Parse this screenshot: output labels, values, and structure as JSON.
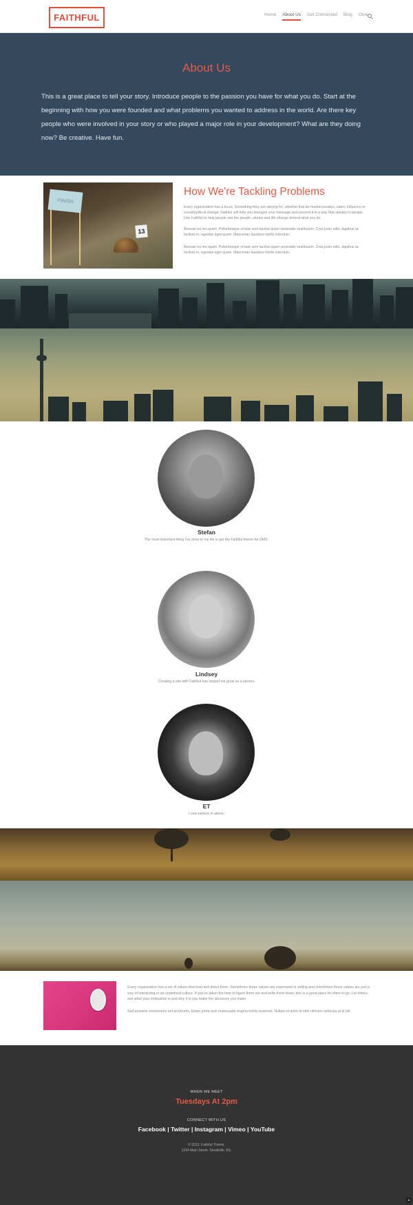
{
  "header": {
    "logo": "FAITHFUL",
    "nav": [
      {
        "label": "Home",
        "active": false
      },
      {
        "label": "About Us",
        "active": true
      },
      {
        "label": "Get Connected",
        "active": false
      },
      {
        "label": "Blog",
        "active": false
      },
      {
        "label": "Give",
        "active": false
      }
    ],
    "search_icon": "search-icon"
  },
  "hero": {
    "title": "About Us",
    "text": "This is a great place to tell your story. Introduce people to the passion you have for what you do. Start at the beginning with how you were founded and what problems you wanted to address in the world. Are there key people who were involved in your story or who played a major role in your development? What are they doing now? Be creative. Have fun."
  },
  "tackling": {
    "image_text": {
      "flag": "FINISH",
      "tag": "13"
    },
    "title": "How We're Tackling Problems",
    "paragraphs": [
      "Every organization has a focus. Something they are striving for, whether that be market position, sales, influence or social/political change. Faithful will help you energize your message and present it in a way that speaks to people. Use Faithful to help people see the people, stories and life change behind what you do.",
      "Aenean eu leo quam. Pellentesque ornare sem lacinia quam venenatis vestibulum. Cras justo odio, dapibus ac facilisis in, egestas eget quam. Maecenas faucibus mollis interdum.",
      "Aenean eu leo quam. Pellentesque ornare sem lacinia quam venenatis vestibulum. Cras justo odio, dapibus ac facilisis in, egestas eget quam. Maecenas faucibus mollis interdum."
    ]
  },
  "team": [
    {
      "name": "Stefan",
      "quote": "The most important thing I've done in my life is get the Faithful theme for DMS."
    },
    {
      "name": "Lindsey",
      "quote": "Creating a site with Faithful has helped me grow as a person."
    },
    {
      "name": "ET",
      "quote": "I now believe in aliens."
    }
  ],
  "values": {
    "paragraphs": [
      "Every organization has a set of values that lead and direct them. Sometimes these values are expressed in writing and sometimes these values are just a way of interacting or an undefined culture. If you've taken the time to figure them out and write them down, this is a good place for them to go. Let others see what your motivation is and why it is you make the decisions you make.",
      "Sed posuere consectetur est at lobortis. Etiam porta sem malesuada magna mollis euismod. Nullam id dolor id nibh ultricies vehicula ut id elit."
    ]
  },
  "footer": {
    "meet_label": "WHEN WE MEET",
    "meet_time": "Tuesdays At 2pm",
    "connect_label": "CONNECT WITH US",
    "social": [
      "Facebook",
      "Twitter",
      "Instagram",
      "Vimeo",
      "YouTube"
    ],
    "separator": " | ",
    "copyright": "© 2013, Faithful Theme.",
    "address": "1234 Main Street, Smallville, KS."
  },
  "colors": {
    "accent": "#e34c3b",
    "hero_bg": "#34495e",
    "footer_bg": "#333333"
  }
}
